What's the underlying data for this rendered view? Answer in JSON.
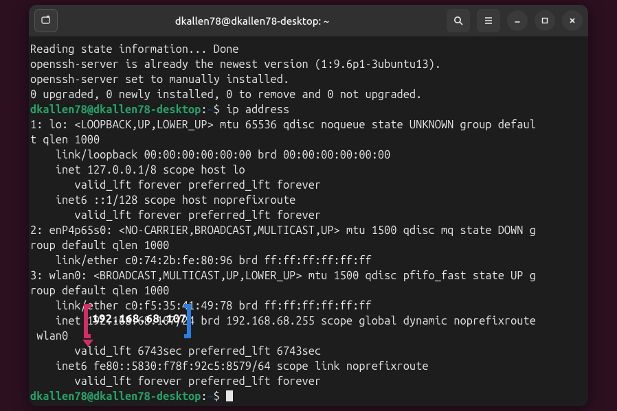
{
  "titlebar": {
    "title": "dkallen78@dkallen78-desktop: ~"
  },
  "highlight": {
    "ip": "192.168.68.107"
  },
  "term": {
    "l0": "Reading state information... Done",
    "l1": "openssh-server is already the newest version (1:9.6p1-3ubuntu13).",
    "l2": "openssh-server set to manually installed.",
    "l3": "0 upgraded, 0 newly installed, 0 to remove and 0 not upgraded.",
    "prompt_user": "dkallen78@dkallen78-desktop",
    "prompt_colon": ":",
    "prompt_tilde": "~",
    "prompt_dollar": "$ ",
    "cmd1": "ip address",
    "l5": "1: lo: <LOOPBACK,UP,LOWER_UP> mtu 65536 qdisc noqueue state UNKNOWN group defaul",
    "l6": "t qlen 1000",
    "l7": "    link/loopback 00:00:00:00:00:00 brd 00:00:00:00:00:00",
    "l8": "    inet 127.0.0.1/8 scope host lo",
    "l9": "       valid_lft forever preferred_lft forever",
    "l10": "    inet6 ::1/128 scope host noprefixroute",
    "l11": "       valid_lft forever preferred_lft forever",
    "l12": "2: enP4p65s0: <NO-CARRIER,BROADCAST,MULTICAST,UP> mtu 1500 qdisc mq state DOWN g",
    "l13": "roup default qlen 1000",
    "l14": "    link/ether c0:74:2b:fe:80:96 brd ff:ff:ff:ff:ff:ff",
    "l15": "3: wlan0: <BROADCAST,MULTICAST,UP,LOWER_UP> mtu 1500 qdisc pfifo_fast state UP g",
    "l16": "roup default qlen 1000",
    "l17": "    link/ether c0:f5:35:41:49:78 brd ff:ff:ff:ff:ff:ff",
    "l18": "    inet 192.168.68.107/24 brd 192.168.68.255 scope global dynamic noprefixroute",
    "l19": " wlan0",
    "l20": "       valid_lft 6743sec preferred_lft 6743sec",
    "l21": "    inet6 fe80::5830:f78f:92c5:8579/64 scope link noprefixroute",
    "l22": "       valid_lft forever preferred_lft forever"
  }
}
